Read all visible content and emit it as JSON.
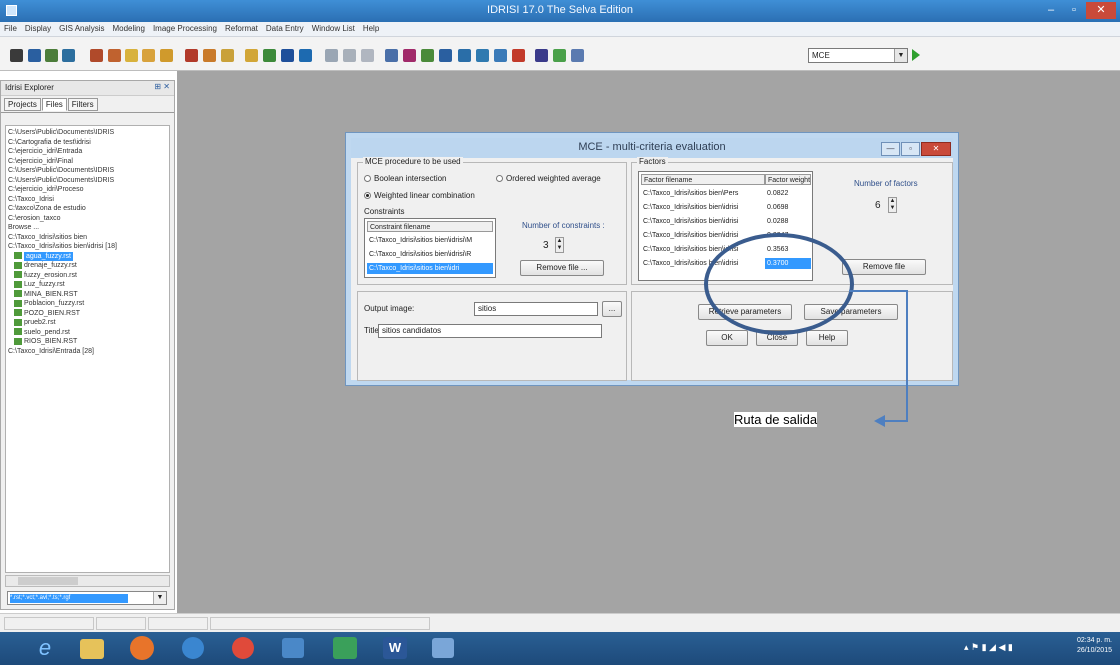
{
  "window": {
    "title": "IDRISI 17.0    The Selva Edition",
    "menu": [
      "File",
      "Display",
      "GIS Analysis",
      "Modeling",
      "Image Processing",
      "Reformat",
      "Data Entry",
      "Window List",
      "Help"
    ],
    "toolbar_combo": "MCE"
  },
  "explorer": {
    "title": "Idrisi Explorer",
    "tabs": [
      "Projects",
      "Files",
      "Filters"
    ],
    "tree": [
      {
        "text": "C:\\Users\\Public\\Documents\\IDRIS",
        "type": "folder"
      },
      {
        "text": "C:\\Cartografia de test\\idrisi",
        "type": "folder"
      },
      {
        "text": "C:\\ejercicio_idri\\Entrada",
        "type": "folder"
      },
      {
        "text": "C:\\ejercicio_idri\\Final",
        "type": "folder"
      },
      {
        "text": "C:\\Users\\Public\\Documents\\IDRIS",
        "type": "folder"
      },
      {
        "text": "C:\\Users\\Public\\Documents\\IDRIS",
        "type": "folder"
      },
      {
        "text": "C:\\ejercicio_idri\\Proceso",
        "type": "folder"
      },
      {
        "text": "C:\\Taxco_Idrisi",
        "type": "folder"
      },
      {
        "text": "C:\\taxco\\Zona de estudio",
        "type": "folder"
      },
      {
        "text": "C:\\erosion_taxco",
        "type": "folder"
      },
      {
        "text": "Browse ...",
        "type": "folder"
      },
      {
        "text": "C:\\Taxco_Idrisi\\sitios bien",
        "type": "folder"
      },
      {
        "text": "C:\\Taxco_Idrisi\\sitios bien\\idrisi [18]",
        "type": "folder"
      },
      {
        "text": "agua_fuzzy.rst",
        "type": "file",
        "selected": true
      },
      {
        "text": "drenaje_fuzzy.rst",
        "type": "file"
      },
      {
        "text": "fuzzy_erosion.rst",
        "type": "file"
      },
      {
        "text": "Luz_fuzzy.rst",
        "type": "file"
      },
      {
        "text": "MINA_BIEN.RST",
        "type": "file"
      },
      {
        "text": "Poblacion_fuzzy.rst",
        "type": "file"
      },
      {
        "text": "POZO_BIEN.RST",
        "type": "file"
      },
      {
        "text": "prueb2.rst",
        "type": "file"
      },
      {
        "text": "suelo_pend.rst",
        "type": "file"
      },
      {
        "text": "RIOS_BIEN.RST",
        "type": "file"
      },
      {
        "text": "C:\\Taxco_Idrisi\\Entrada [28]",
        "type": "folder"
      }
    ],
    "filter": "*.rst;*.vct;*.avl;*.ts;*.rgf"
  },
  "dialog": {
    "title": "MCE - multi-criteria evaluation",
    "procedure_legend": "MCE procedure to be used",
    "opt_boolean": "Boolean intersection",
    "opt_owa": "Ordered weighted average",
    "opt_wlc": "Weighted linear combination",
    "constraints_label": "Constraints",
    "constraint_header": "Constraint filename",
    "constraints": [
      "C:\\Taxco_Idrisi\\sitios bien\\idrisi\\M",
      "C:\\Taxco_Idrisi\\sitios bien\\idrisi\\R",
      "C:\\Taxco_Idrisi\\sitios bien\\idri"
    ],
    "num_constraints_label": "Number of constraints :",
    "num_constraints": "3",
    "remove_file": "Remove file ...",
    "factors_legend": "Factors",
    "factor_header": "Factor filename",
    "weight_header": "Factor weight",
    "factors": [
      {
        "file": "C:\\Taxco_Idrisi\\sitios bien\\Pers",
        "weight": "0.0822"
      },
      {
        "file": "C:\\Taxco_Idrisi\\sitios bien\\idrisi",
        "weight": "0.0698"
      },
      {
        "file": "C:\\Taxco_Idrisi\\sitios bien\\idrisi",
        "weight": "0.0288"
      },
      {
        "file": "C:\\Taxco_Idrisi\\sitios bien\\idrisi",
        "weight": "0.0047"
      },
      {
        "file": "C:\\Taxco_Idrisi\\sitios bien\\idrisi",
        "weight": "0.3563"
      },
      {
        "file": "C:\\Taxco_Idrisi\\sitios bien\\idrisi",
        "weight": "0.3700"
      }
    ],
    "num_factors_label": "Number of factors",
    "num_factors": "6",
    "remove_file2": "Remove file",
    "output_label": "Output image:",
    "output_value": "sitios",
    "title_label": "Title:",
    "title_value": "sitios candidatos",
    "retrieve": "Retrieve parameters",
    "save_params": "Save parameters",
    "ok": "OK",
    "close": "Close",
    "help": "Help"
  },
  "annotation": "Ruta de salida",
  "tray": {
    "time": "02:34 p. m.",
    "date": "26/10/2015"
  }
}
